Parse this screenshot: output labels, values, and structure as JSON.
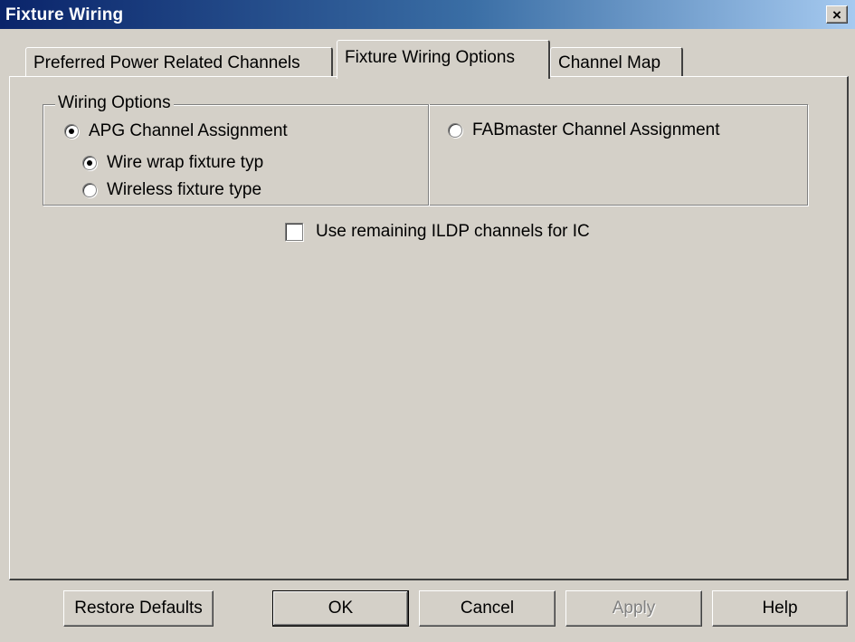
{
  "window": {
    "title": "Fixture Wiring",
    "close_glyph": "×"
  },
  "tabs": [
    {
      "label": "Preferred Power Related Channels",
      "selected": false
    },
    {
      "label": "Fixture Wiring Options",
      "selected": true
    },
    {
      "label": "Channel Map",
      "selected": false
    }
  ],
  "wiring_options": {
    "legend": "Wiring Options",
    "apg": {
      "label": "APG Channel Assignment",
      "checked": true
    },
    "wire_wrap": {
      "label": "Wire wrap fixture typ",
      "checked": true
    },
    "wireless": {
      "label": "Wireless fixture type",
      "checked": false
    },
    "fabmaster": {
      "label": "FABmaster Channel Assignment",
      "checked": false
    }
  },
  "ildp": {
    "label": "Use remaining ILDP channels for IC",
    "checked": false
  },
  "buttons": {
    "restore": "Restore Defaults",
    "ok": "OK",
    "cancel": "Cancel",
    "apply": "Apply",
    "help": "Help"
  },
  "icons": {
    "close": "close-icon",
    "radio": "radio-icon",
    "checkbox": "checkbox-icon"
  }
}
